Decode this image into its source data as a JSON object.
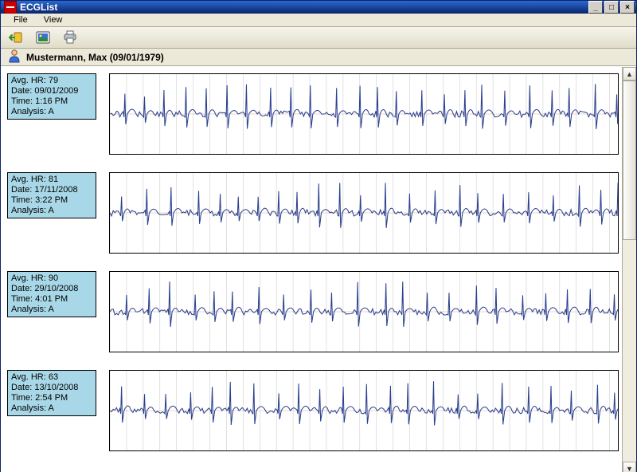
{
  "window": {
    "title": "ECGList"
  },
  "menu": {
    "file": "File",
    "view": "View"
  },
  "patient": {
    "label": "Mustermann, Max (09/01/1979)"
  },
  "records": [
    {
      "hr_label": "Avg. HR: 79",
      "date_label": "Date: 09/01/2009",
      "time_label": "Time: 1:16 PM",
      "analysis_label": "Analysis: A",
      "seed": 79
    },
    {
      "hr_label": "Avg. HR: 81",
      "date_label": "Date: 17/11/2008",
      "time_label": "Time: 3:22 PM",
      "analysis_label": "Analysis: A",
      "seed": 81
    },
    {
      "hr_label": "Avg. HR: 90",
      "date_label": "Date: 29/10/2008",
      "time_label": "Time: 4:01 PM",
      "analysis_label": "Analysis: A",
      "seed": 90
    },
    {
      "hr_label": "Avg. HR: 63",
      "date_label": "Date: 13/10/2008",
      "time_label": "Time: 2:54 PM",
      "analysis_label": "Analysis: A",
      "seed": 63
    }
  ],
  "colors": {
    "info_bg": "#a8d8e8",
    "trace": "#2a3f8f",
    "grid": "#d0d0d0"
  }
}
